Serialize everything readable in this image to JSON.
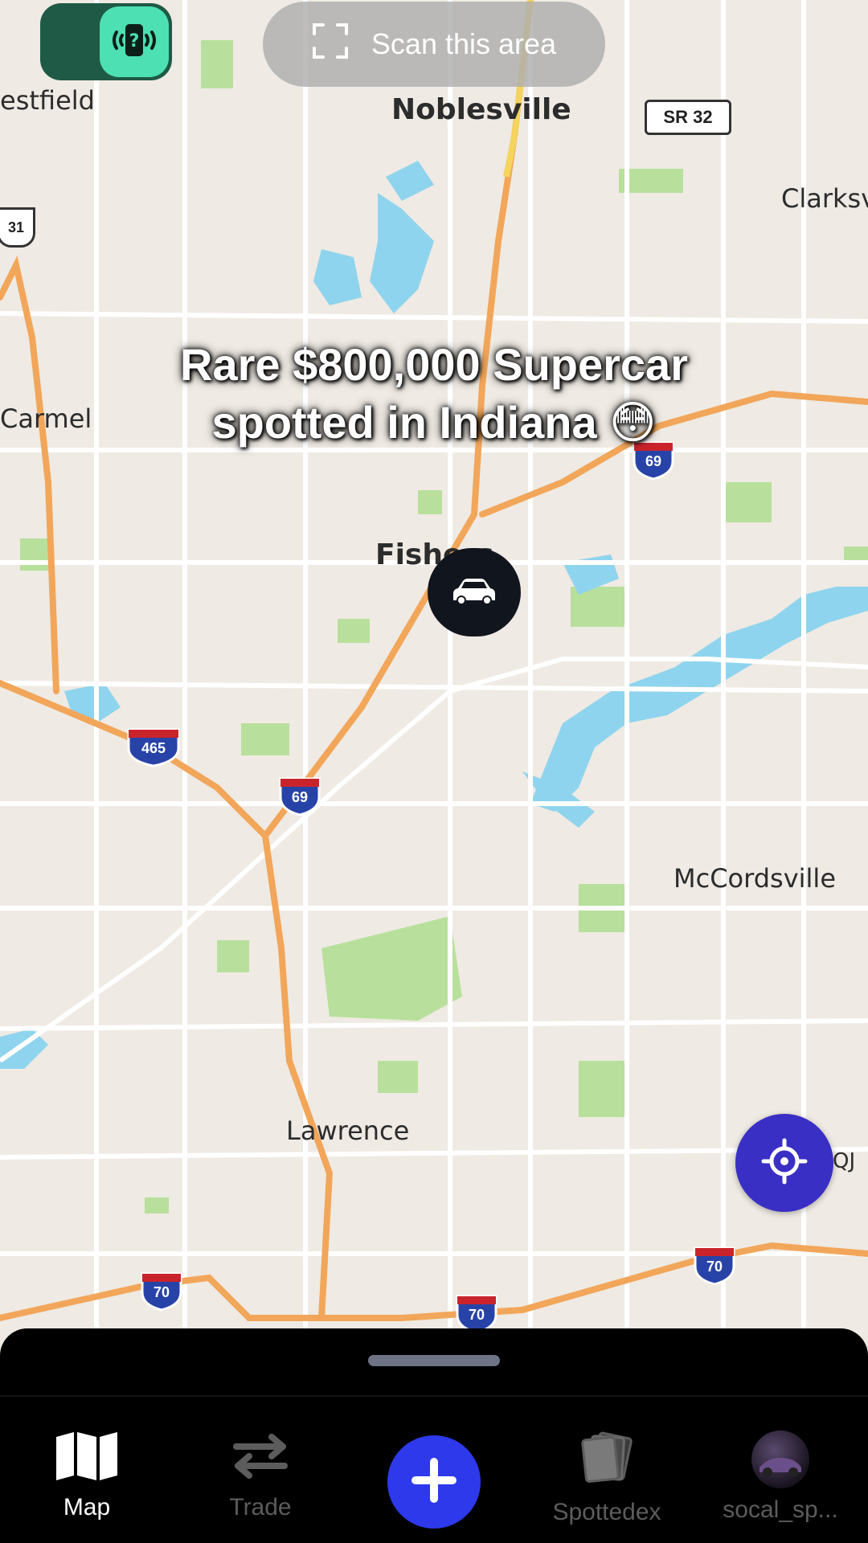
{
  "map": {
    "labels": {
      "westfield": "estfield",
      "noblesville": "Noblesville",
      "clarksville": "Clarksvi",
      "carmel": "Carmel",
      "fishers": "Fishers",
      "mccordsville": "McCordsville",
      "lawrence": "Lawrence",
      "airport_code": "QJ"
    },
    "road_shields": {
      "sr32": "SR 32",
      "us31": "31",
      "i69_north": "69",
      "i69_south": "69",
      "i465": "465",
      "i70_west": "70",
      "i70_center": "70",
      "i70_east": "70"
    },
    "colors": {
      "land": "#efeae3",
      "water": "#8fd4ee",
      "park": "#b8e09c",
      "highway": "#f2a65a",
      "road": "#ffffff"
    }
  },
  "top_bar": {
    "toggle_icon": "question-device-icon",
    "scan_label": "Scan this area",
    "scan_icon": "scan-frame-icon"
  },
  "caption": {
    "line1": "Rare $800,000 Supercar",
    "line2": "spotted in Indiana 😳"
  },
  "markers": {
    "car_icon": "car-icon"
  },
  "locate_button": {
    "icon": "crosshair-icon"
  },
  "bottom_nav": {
    "items": [
      {
        "label": "Map",
        "icon": "map-icon",
        "active": true
      },
      {
        "label": "Trade",
        "icon": "swap-arrows-icon",
        "active": false
      },
      {
        "label": "",
        "icon": "plus-icon",
        "active": false
      },
      {
        "label": "Spottedex",
        "icon": "cards-icon",
        "active": false
      },
      {
        "label": "socal_sp...",
        "icon": "avatar",
        "active": false
      }
    ],
    "accent_color": "#2d39ea"
  }
}
